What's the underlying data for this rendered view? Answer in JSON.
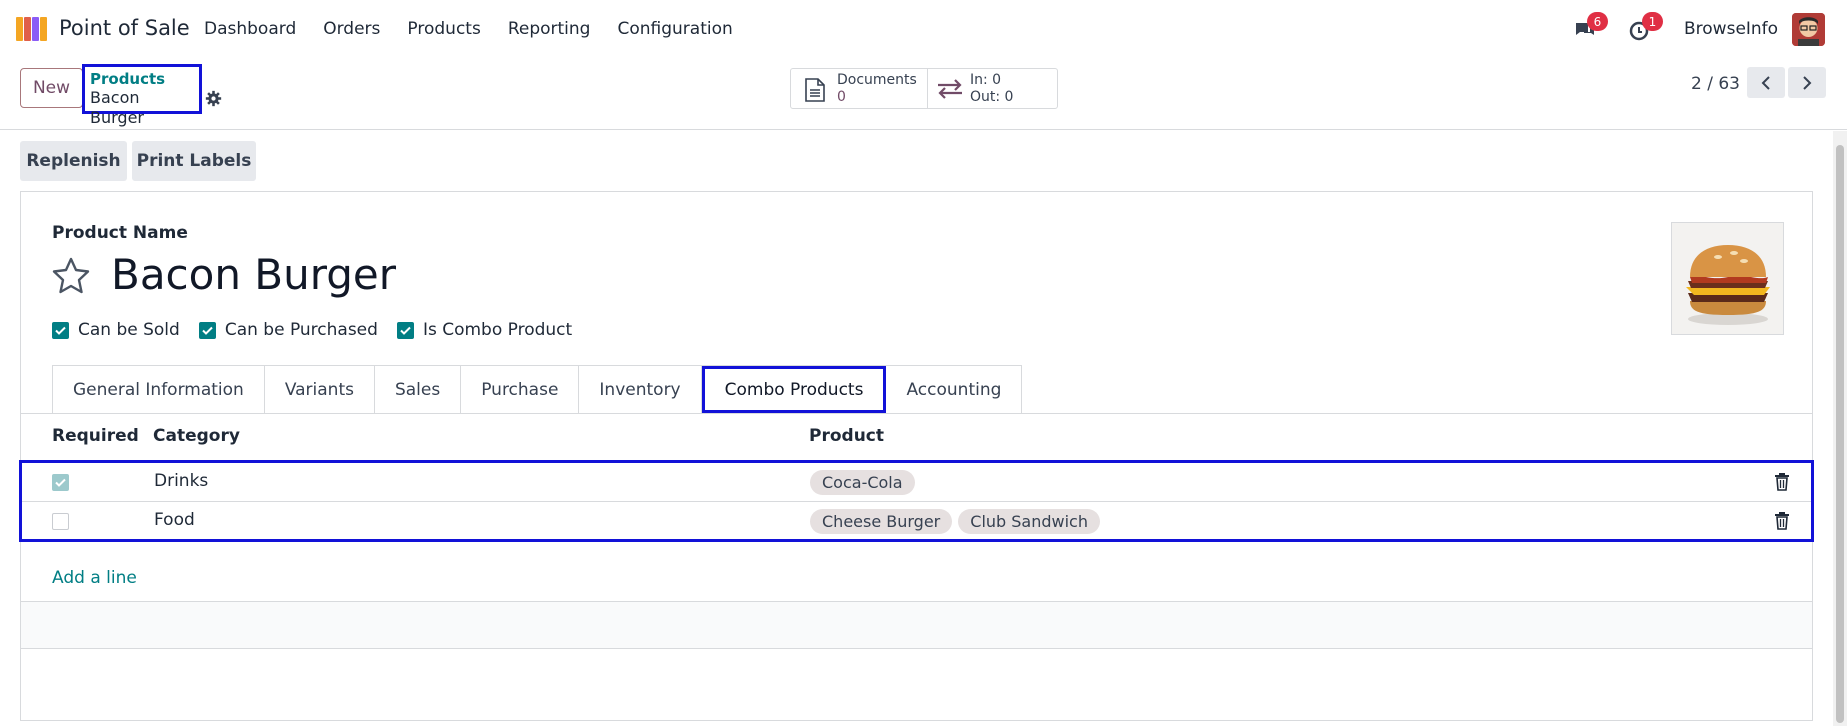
{
  "navbar": {
    "app_name": "Point of Sale",
    "menu": [
      "Dashboard",
      "Orders",
      "Products",
      "Reporting",
      "Configuration"
    ],
    "messages_badge": "6",
    "activities_badge": "1",
    "company": "BrowseInfo"
  },
  "control": {
    "new_label": "New",
    "breadcrumb_parent": "Products",
    "breadcrumb_current": "Bacon Burger",
    "documents_label": "Documents",
    "documents_count": "0",
    "in_label": "In: 0",
    "out_label": "Out: 0",
    "pager": "2 / 63"
  },
  "actions": {
    "replenish": "Replenish",
    "print_labels": "Print Labels"
  },
  "form": {
    "name_label": "Product Name",
    "product_name": "Bacon Burger",
    "checkboxes": [
      "Can be Sold",
      "Can be Purchased",
      "Is Combo Product"
    ],
    "tabs": [
      "General Information",
      "Variants",
      "Sales",
      "Purchase",
      "Inventory",
      "Combo Products",
      "Accounting"
    ],
    "active_tab": "Combo Products"
  },
  "combo_table": {
    "headers": [
      "Required",
      "Category",
      "Product"
    ],
    "rows": [
      {
        "required": true,
        "category": "Drinks",
        "products": [
          "Coca-Cola"
        ]
      },
      {
        "required": false,
        "category": "Food",
        "products": [
          "Cheese Burger",
          "Club Sandwich"
        ]
      }
    ],
    "add_line": "Add a line"
  },
  "colors": {
    "brand": "#714b67",
    "accent": "#017e84",
    "highlight": "#1212d8",
    "badge": "#e02f44"
  }
}
